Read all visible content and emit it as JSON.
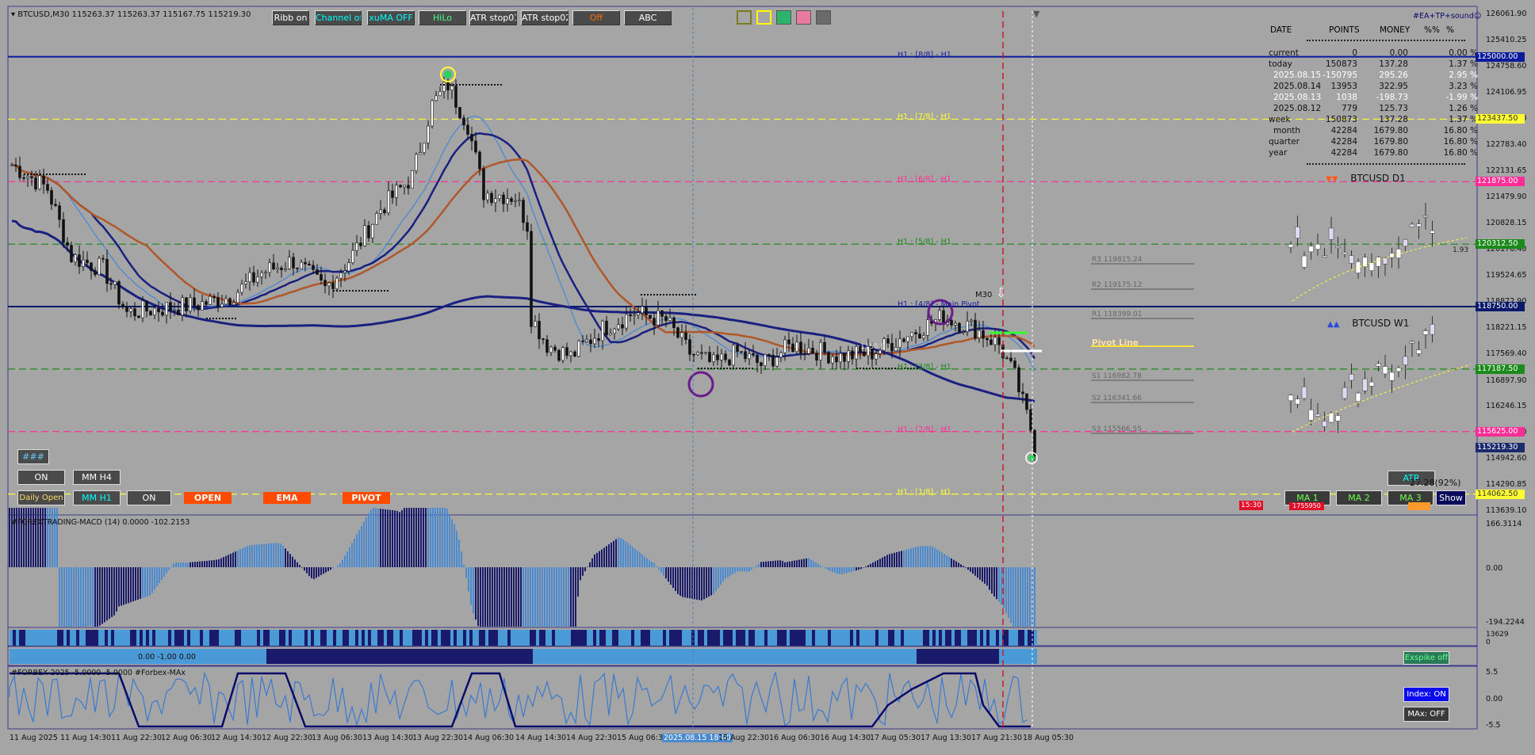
{
  "chart_header": {
    "symbol_info": "BTCUSD,M30  115263.37 115263.37 115167.75 115219.30",
    "indicator_label": "#EA+TP+sound☺"
  },
  "toolbar": {
    "buttons": [
      {
        "label": "Ribb on",
        "fg": "#ffffff",
        "bg": "#4a4a4a"
      },
      {
        "label": "Channel off",
        "fg": "#00ffff",
        "bg": "#4a4a4a"
      },
      {
        "label": "xuMA OFF",
        "fg": "#00ffff",
        "bg": "#4a4a4a"
      },
      {
        "label": "HiLo",
        "fg": "#44ff88",
        "bg": "#4a4a4a"
      },
      {
        "label": "ATR stop01",
        "fg": "#ffffff",
        "bg": "#4a4a4a"
      },
      {
        "label": "ATR stop02",
        "fg": "#ffffff",
        "bg": "#4a4a4a"
      },
      {
        "label": "Off",
        "fg": "#ff6a00",
        "bg": "#4a4a4a"
      },
      {
        "label": "ABC",
        "fg": "#ffffff",
        "bg": "#4a4a4a"
      }
    ],
    "swatch_colors": [
      "#7a7a20",
      "#ffff00",
      "#2db36a",
      "#e87aa0",
      "#6a6a6a"
    ]
  },
  "stats_table": {
    "headers": [
      "DATE",
      "POINTS",
      "MONEY",
      "%%",
      "%"
    ],
    "rows": [
      {
        "date": "current",
        "points": "0",
        "money": "0.00",
        "pct": "0.00 %",
        "color": "#111111"
      },
      {
        "date": "today",
        "points": "150873",
        "money": "137.28",
        "pct": "1.37 %",
        "color": "#111111"
      },
      {
        "date": "2025.08.15",
        "points": "-150795",
        "money": "295.26",
        "pct": "2.95 %",
        "color": "#ffffff"
      },
      {
        "date": "2025.08.14",
        "points": "13953",
        "money": "322.95",
        "pct": "3.23 %",
        "color": "#111111"
      },
      {
        "date": "2025.08.13",
        "points": "1038",
        "money": "-198.73",
        "pct": "-1.99 %",
        "color": "#ffffff"
      },
      {
        "date": "2025.08.12",
        "points": "779",
        "money": "125.73",
        "pct": "1.26 %",
        "color": "#111111"
      },
      {
        "date": "week",
        "points": "150873",
        "money": "137.28",
        "pct": "1.37 %",
        "color": "#111111"
      },
      {
        "date": "month",
        "points": "42284",
        "money": "1679.80",
        "pct": "16.80 %",
        "color": "#111111"
      },
      {
        "date": "quarter",
        "points": "42284",
        "money": "1679.80",
        "pct": "16.80 %",
        "color": "#111111"
      },
      {
        "date": "year",
        "points": "42284",
        "money": "1679.80",
        "pct": "16.80 %",
        "color": "#111111"
      }
    ]
  },
  "mini_charts": {
    "d1_title": "BTCUSD D1",
    "w1_title": "BTCUSD W1"
  },
  "murrey_levels": [
    {
      "label": "H1 : [8/8] - H1",
      "price": 125000.0,
      "color": "#0a1a9a"
    },
    {
      "label": "H1 : [7/8] - H1",
      "price": 123437.5,
      "color": "#ffff33"
    },
    {
      "label": "H1 : [6/8] - H1",
      "price": 121875.0,
      "color": "#ff2d95"
    },
    {
      "label": "H1 : [5/8] - H1",
      "price": 120312.5,
      "color": "#1a8a1a"
    },
    {
      "label": "H1 : [4/8] - Main Pivot",
      "price": 118750.0,
      "color": "#0a1a6a"
    },
    {
      "label": "H1 : [3/8] - H1",
      "price": 117187.5,
      "color": "#1a8a1a"
    },
    {
      "label": "H1 : [2/8] - H1",
      "price": 115625.0,
      "color": "#ff2d95"
    },
    {
      "label": "H1 : [1/8] - H1",
      "price": 114062.5,
      "color": "#ffff33"
    }
  ],
  "pivot_levels": [
    {
      "label": "R3 119815.24"
    },
    {
      "label": "R2 119175.12"
    },
    {
      "label": "R1 118399.01"
    },
    {
      "label": "Pivot Line"
    },
    {
      "label": "S1 116982.78"
    },
    {
      "label": "S2 116341.66"
    },
    {
      "label": "S3 115566.55"
    }
  ],
  "price_scale": [
    "126061.90",
    "125410.25",
    "124758.60",
    "124106.95",
    "123437.50",
    "122783.40",
    "122131.65",
    "121479.90",
    "120828.15",
    "120176.40",
    "119524.65",
    "118872.90",
    "118221.15",
    "117569.40",
    "116897.90",
    "116246.15",
    "115594.40",
    "114942.60",
    "114290.85",
    "113639.10"
  ],
  "price_tags": [
    {
      "text": "125000.00",
      "bg": "#0a1a9a",
      "fg": "#ffffff",
      "price": 125000.0
    },
    {
      "text": "123437.50",
      "bg": "#ffff33",
      "fg": "#333333",
      "price": 123437.5
    },
    {
      "text": "121875.00",
      "bg": "#ff2d95",
      "fg": "#ffffff",
      "price": 121875.0
    },
    {
      "text": "120312.50",
      "bg": "#1a8a1a",
      "fg": "#ffffff",
      "price": 120312.5
    },
    {
      "text": "118750.00",
      "bg": "#0a1a6a",
      "fg": "#ffffff",
      "price": 118750.0
    },
    {
      "text": "117187.50",
      "bg": "#1a8a1a",
      "fg": "#ffffff",
      "price": 117187.5
    },
    {
      "text": "115625.00",
      "bg": "#ff2d95",
      "fg": "#ffffff",
      "price": 115625.0
    },
    {
      "text": "115219.30",
      "bg": "#1a2a6a",
      "fg": "#ffffff",
      "price": 115219.3
    },
    {
      "text": "114062.50",
      "bg": "#ffff33",
      "fg": "#333333",
      "price": 114062.5
    }
  ],
  "chart_labels": {
    "m30": "M30",
    "atr": "ATR",
    "atr_value": "27.28(92%)",
    "time_badge": "15:30",
    "small_val": "1755950",
    "pivot_small": "1155.9",
    "right_small": "1.93"
  },
  "bottom_buttons": {
    "hash": "###",
    "on": "ON",
    "mm_h4": "MM H4",
    "daily_open": "Daily Open",
    "mm_h1": "MM H1",
    "on2": "ON",
    "open": "OPEN",
    "ema": "EMA",
    "pivot": "PIVOT",
    "ma1": "MA 1",
    "ma2": "MA 2",
    "ma3": "MA 3",
    "show": "Show"
  },
  "macd": {
    "label": "#FOREXTRADING-MACD (14) 0.0000 -102.2153",
    "scale": [
      "166.3114",
      "0.00",
      "-194.2244"
    ]
  },
  "strip1": {
    "label": "",
    "scale": [
      "13629",
      "0"
    ]
  },
  "strip2": {
    "label": "0.00 -1.00 0.00",
    "button": "Exspike off"
  },
  "forbex": {
    "label": "#FORBEX-2025 -5.0000 -5.0000  #Forbex-MAx",
    "scale": [
      "5.5",
      "0.00",
      "-5.5"
    ],
    "index_button": "Index: ON",
    "max_button": "MAx: OFF"
  },
  "time_axis": [
    "11 Aug 2025",
    "11 Aug 14:30",
    "11 Aug 22:30",
    "12 Aug 06:30",
    "12 Aug 14:30",
    "12 Aug 22:30",
    "13 Aug 06:30",
    "13 Aug 14:30",
    "13 Aug 22:30",
    "14 Aug 06:30",
    "14 Aug 14:30",
    "14 Aug 22:30",
    "15 Aug 06:30",
    "2025.08.15 18:00",
    "15 Aug 22:30",
    "16 Aug 06:30",
    "16 Aug 14:30",
    "17 Aug 05:30",
    "17 Aug 13:30",
    "17 Aug 21:30",
    "18 Aug 05:30"
  ],
  "colors": {
    "background": "#a5a5a5",
    "candle": "#111111",
    "ribbon_blue": "#2a3a8a",
    "ribbon_brown": "#b0582a",
    "light_blue": "#4a8ad0",
    "navy": "#1a2080"
  }
}
